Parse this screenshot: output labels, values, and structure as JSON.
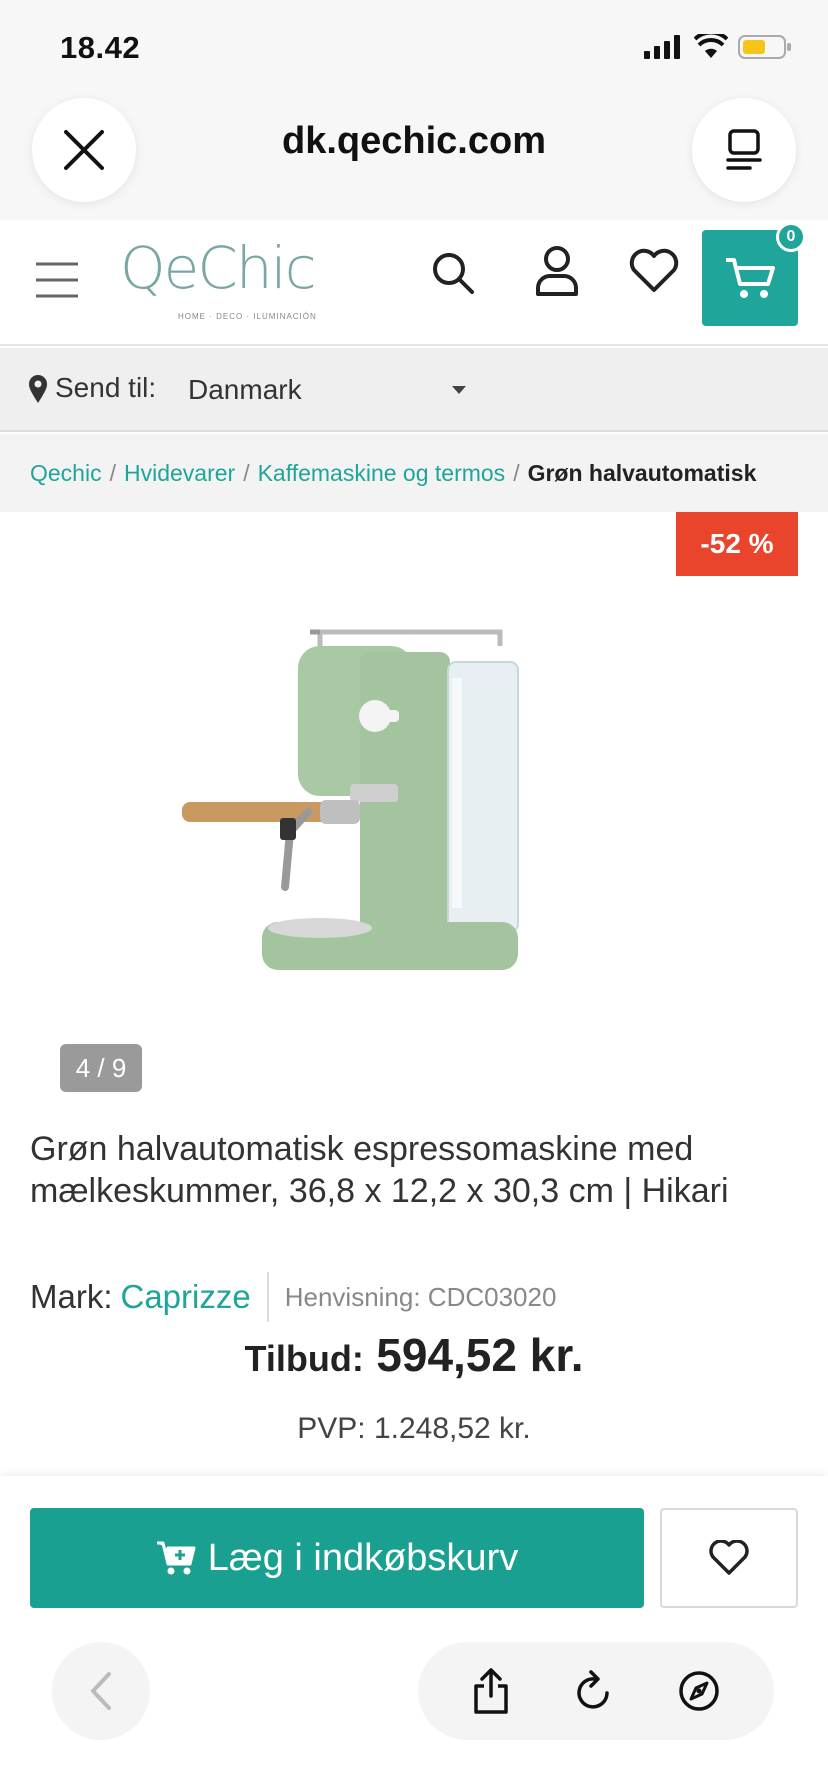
{
  "status_bar": {
    "time": "18.42"
  },
  "browser": {
    "url": "dk.qechic.com"
  },
  "site": {
    "logo_text": "QeChic",
    "logo_tagline": "HOME · DECO · ILUMINACIÓN",
    "cart_count": "0",
    "accent_color": "#1fa599"
  },
  "ship_to": {
    "label": "Send til:",
    "country": "Danmark"
  },
  "breadcrumb": {
    "items": [
      "Qechic",
      "Hvidevarer",
      "Kaffemaskine og termos"
    ],
    "current": "Grøn halvautomatisk"
  },
  "gallery": {
    "discount": "-52 %",
    "counter": "4 / 9"
  },
  "product": {
    "title": "Grøn halvautomatisk espressomaskine med mælkeskummer, 36,8 x 12,2 x 30,3 cm | Hikari",
    "mark_label": "Mark:",
    "brand": "Caprizze",
    "reference": "Henvisning: CDC03020",
    "offer_label": "Tilbud:",
    "offer_price": "594,52 kr.",
    "pvp": "PVP: 1.248,52 kr."
  },
  "actions": {
    "add_to_cart": "Læg i indkøbskurv"
  }
}
